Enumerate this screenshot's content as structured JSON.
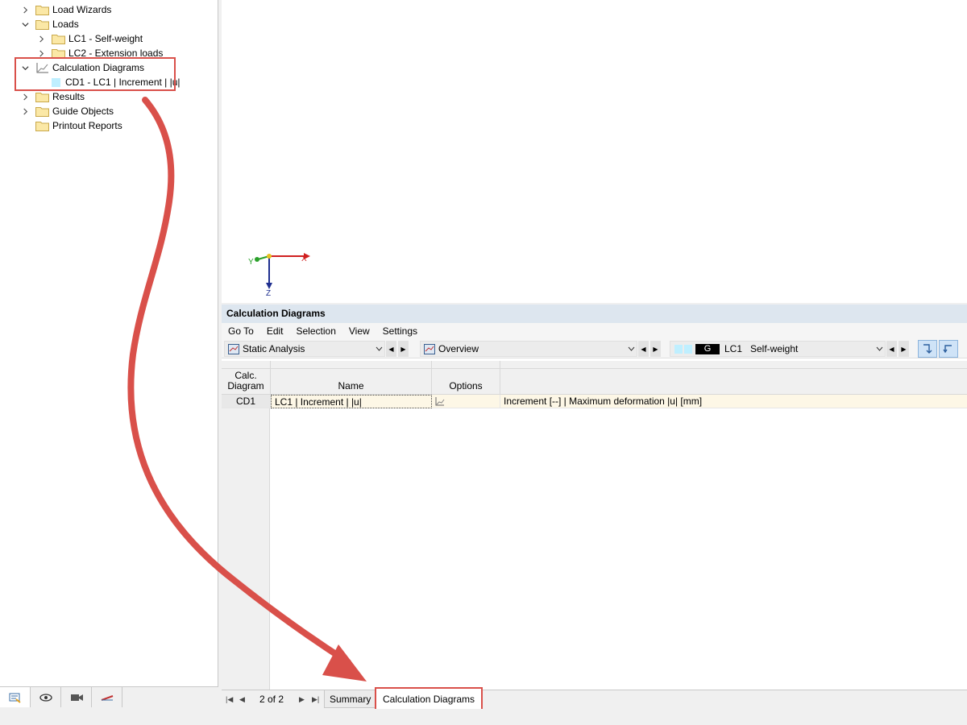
{
  "navigator": {
    "tree": [
      {
        "label": "Load Wizards",
        "expanded": false
      },
      {
        "label": "Loads",
        "expanded": true
      },
      {
        "label": "LC1 - Self-weight",
        "expanded": false
      },
      {
        "label": "LC2 - Extension loads",
        "expanded": false
      },
      {
        "label": "Calculation Diagrams",
        "expanded": true
      },
      {
        "label": "CD1 - LC1 | Increment | |u|"
      },
      {
        "label": "Results",
        "expanded": false
      },
      {
        "label": "Guide Objects",
        "expanded": false
      },
      {
        "label": "Printout Reports"
      }
    ],
    "bottom_tabs": [
      "data-icon",
      "eye-icon",
      "video-camera-icon",
      "views-icon"
    ]
  },
  "viewport": {
    "axes": {
      "x": "X",
      "y": "Y",
      "z": "Z"
    }
  },
  "panel": {
    "title": "Calculation Diagrams",
    "menu": [
      "Go To",
      "Edit",
      "Selection",
      "View",
      "Settings"
    ],
    "toolbar": {
      "analysis": "Static Analysis",
      "view": "Overview",
      "lc_badge": "G",
      "lc_id": "LC1",
      "lc_name": "Self-weight"
    },
    "table": {
      "headers": {
        "col0": "Calc.\nDiagram",
        "col0_line1": "Calc.",
        "col0_line2": "Diagram",
        "col1": "Name",
        "col2": "Options",
        "col3": ""
      },
      "rows": [
        {
          "id": "CD1",
          "name": "LC1 | Increment | |u|",
          "options": "",
          "description": "Increment [--] | Maximum deformation |u| [mm]"
        }
      ]
    }
  },
  "sheet_tabs": {
    "page": "2 of 2",
    "tabs": [
      "Summary",
      "Calculation Diagrams"
    ],
    "active": "Calculation Diagrams"
  },
  "colors": {
    "highlight": "#d9504a",
    "panel_title_bg": "#dde6ef",
    "cd_swatch": "#bfefff",
    "row_bg": "#fdf7e6"
  }
}
